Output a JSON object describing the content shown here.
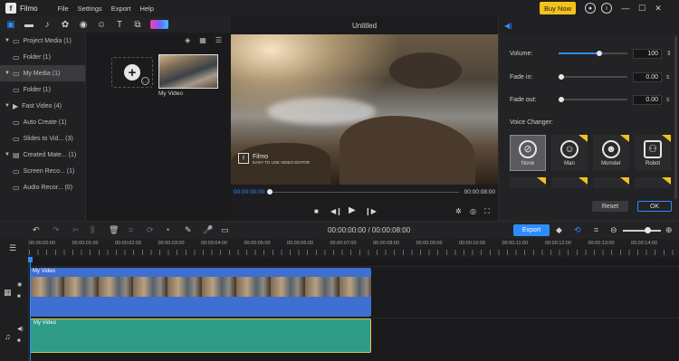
{
  "app": {
    "name": "Filmo"
  },
  "menu": [
    "File",
    "Settings",
    "Export",
    "Help"
  ],
  "titlebar": {
    "buy_label": "Buy Now"
  },
  "media_tree": [
    {
      "label": "Project Media  (1)",
      "level": 0
    },
    {
      "label": "Folder  (1)",
      "level": 1
    },
    {
      "label": "My Media  (1)",
      "level": 0
    },
    {
      "label": "Folder  (1)",
      "level": 1
    },
    {
      "label": "Fast Video  (4)",
      "level": 0
    },
    {
      "label": "Auto Create  (1)",
      "level": 1
    },
    {
      "label": "Slides to Vid...  (3)",
      "level": 1
    },
    {
      "label": "Created Mate...  (1)",
      "level": 0
    },
    {
      "label": "Screen Reco...  (1)",
      "level": 1
    },
    {
      "label": "Audio Recor...  (0)",
      "level": 1
    }
  ],
  "media": {
    "thumb_label": "My Video"
  },
  "preview": {
    "title": "Untitled",
    "watermark_title": "Filmo",
    "watermark_sub": "EASY TO USE VIDEO EDITOR",
    "current_time": "00:00:00:00",
    "total_time": "00:00:08:00"
  },
  "props": {
    "volume_label": "Volume:",
    "volume_value": "100",
    "fade_in_label": "Fade in:",
    "fade_in_value": "0.00",
    "fade_out_label": "Fade out:",
    "fade_out_value": "0.00",
    "unit_s": "s",
    "voice_changer_label": "Voice Changer:",
    "voices": [
      "None",
      "Man",
      "Monster",
      "Robot"
    ],
    "reset_label": "Reset",
    "ok_label": "OK"
  },
  "timeline": {
    "time_display": "00:00:00:00 / 00:00:08:00",
    "export_label": "Export",
    "ticks": [
      "00:00:00:00",
      "00:00:01:00",
      "00:00:02:00",
      "00:00:03:00",
      "00:00:04:00",
      "00:00:05:00",
      "00:00:06:00",
      "00:00:07:00",
      "00:00:08:00",
      "00:00:09:00",
      "00:00:10:00",
      "00:00:11:00",
      "00:00:12:00",
      "00:00:13:00",
      "00:00:14:00"
    ],
    "video_clip_label": "My Video",
    "audio_clip_label": "My Video"
  }
}
